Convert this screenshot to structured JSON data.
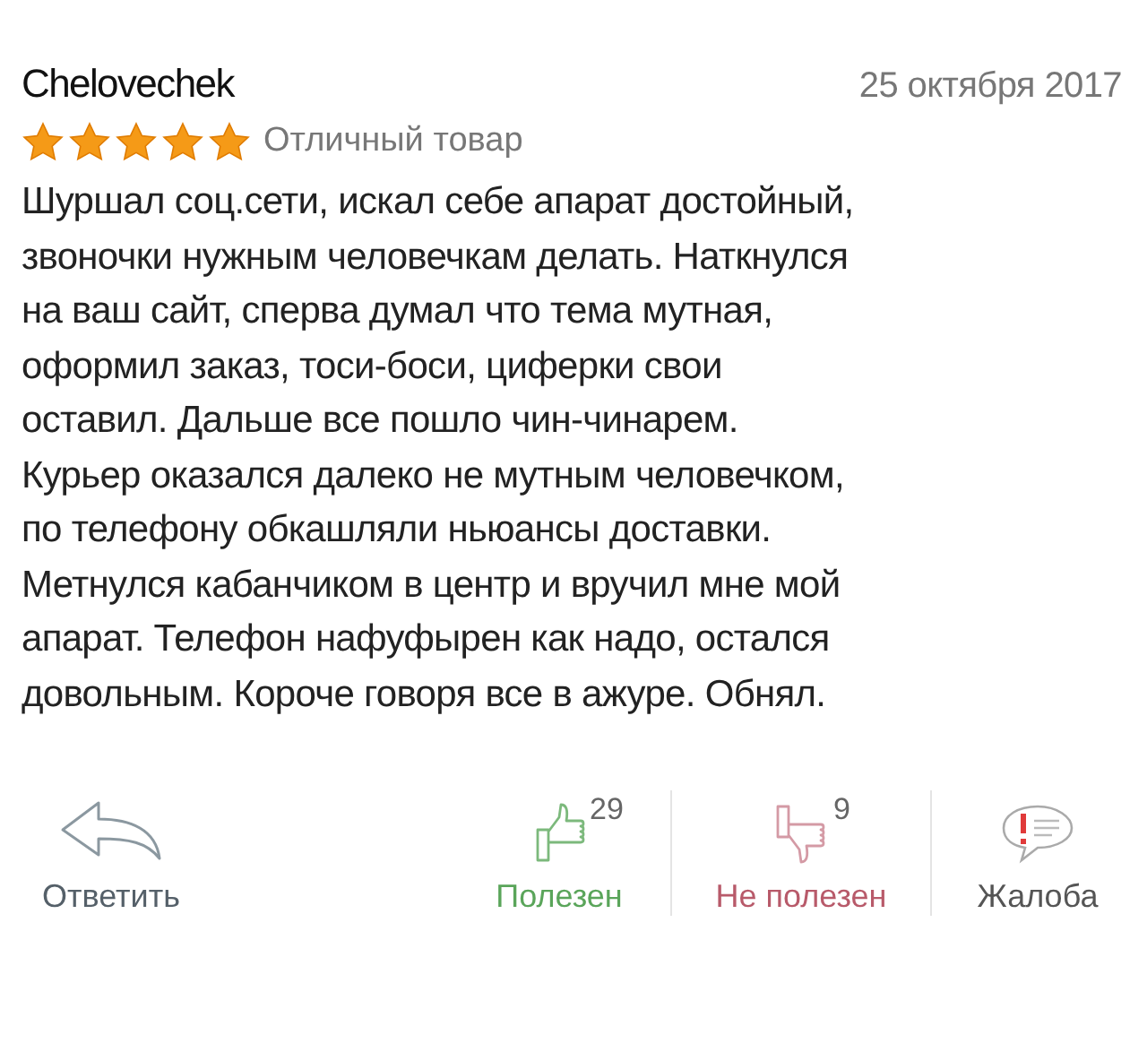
{
  "review": {
    "author": "Chelovechek",
    "date": "25 октября 2017",
    "stars": 5,
    "verdict": "Отличный товар",
    "body_lines": [
      "Шуршал соц.сети, искал себе апарат достойный,",
      "звоночки нужным человечкам делать. Наткнулся",
      "на ваш сайт, сперва думал что тема мутная,",
      "оформил заказ, тоси-боси, циферки свои",
      "оставил. Дальше все пошло чин-чинарем.",
      "Курьер оказался далеко не мутным человечком,",
      "по телефону обкашляли ньюансы доставки.",
      "Метнулся кабанчиком в центр и вручил мне мой",
      "апарат. Телефон нафуфырен как надо, остался",
      "довольным. Короче говоря все в ажуре. Обнял."
    ]
  },
  "actions": [
    {
      "kind": "reply",
      "label": "Ответить"
    },
    {
      "kind": "helpful",
      "label": "Полезен",
      "count": "29"
    },
    {
      "kind": "not_helpful",
      "label": "Не полезен",
      "count": "9"
    },
    {
      "kind": "complaint",
      "label": "Жалоба"
    }
  ]
}
